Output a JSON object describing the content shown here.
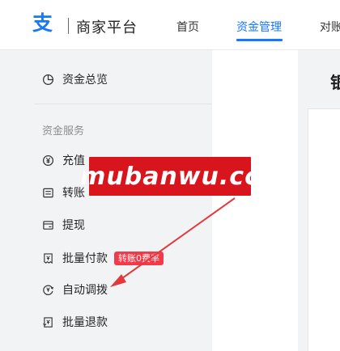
{
  "header": {
    "logo_glyph": "支",
    "brand": "商家平台",
    "nav": [
      {
        "label": "首页",
        "active": false
      },
      {
        "label": "资金管理",
        "active": true
      },
      {
        "label": "对账",
        "active": false
      }
    ]
  },
  "sidebar": {
    "overview": {
      "label": "资金总览",
      "icon": "pie-chart-icon"
    },
    "group_title": "资金服务",
    "items": [
      {
        "label": "充值",
        "icon": "yuan-circle-icon"
      },
      {
        "label": "转账",
        "icon": "transfer-icon"
      },
      {
        "label": "提现",
        "icon": "withdraw-icon"
      },
      {
        "label": "批量付款",
        "icon": "batch-pay-icon",
        "badge": "转账0费率"
      },
      {
        "label": "自动调拨",
        "icon": "auto-allocate-icon"
      },
      {
        "label": "批量退款",
        "icon": "batch-refund-icon"
      }
    ]
  },
  "content": {
    "heading": "银"
  },
  "watermark": {
    "text": "mubanwu.cc"
  },
  "colors": {
    "accent": "#1677ff",
    "watermark_bg": "#d8141c",
    "arrow": "#e23a3a",
    "badge_bg": "#f23a4a"
  }
}
